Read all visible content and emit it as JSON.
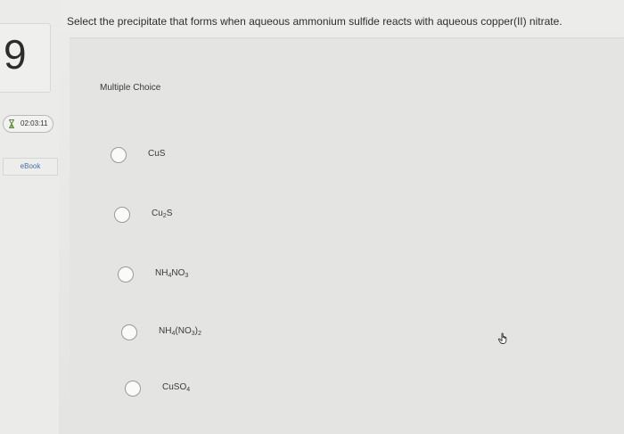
{
  "question_number": "9",
  "timer": "02:03:11",
  "ebook_label": "eBook",
  "question_text": "Select the precipitate that forms when aqueous ammonium sulfide reacts with aqueous copper(II) nitrate.",
  "question_type": "Multiple Choice",
  "options": [
    {
      "id": "a",
      "label": "CuS"
    },
    {
      "id": "b",
      "label": "Cu2S"
    },
    {
      "id": "c",
      "label": "NH4NO3"
    },
    {
      "id": "d",
      "label": "NH4(NO3)2"
    },
    {
      "id": "e",
      "label": "CuSO4"
    }
  ],
  "icons": {
    "timer": "hourglass-icon",
    "cursor": "hand-pointer-icon"
  },
  "colors": {
    "ebook_link": "#4a6fa8",
    "background": "#e9e9e7"
  }
}
